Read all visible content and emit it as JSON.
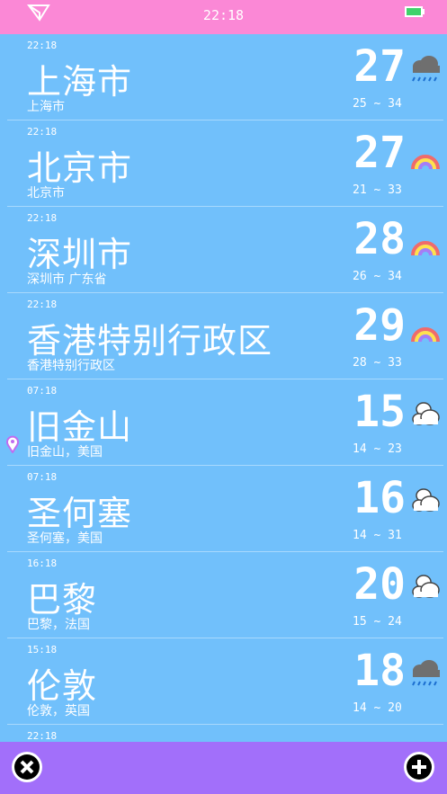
{
  "status_bar": {
    "time": "22:18",
    "location_icon": "location-arrow-icon",
    "battery_icon": "battery-icon"
  },
  "cities": [
    {
      "local_time": "22:18",
      "name": "上海市",
      "subtitle": "上海市",
      "temp": "27",
      "range": "25 ~ 34",
      "weather_icon": "rain-cloud-icon",
      "current_location": false
    },
    {
      "local_time": "22:18",
      "name": "北京市",
      "subtitle": "北京市",
      "temp": "27",
      "range": "21 ~ 33",
      "weather_icon": "rainbow-icon",
      "current_location": false
    },
    {
      "local_time": "22:18",
      "name": "深圳市",
      "subtitle": "深圳市 广东省",
      "temp": "28",
      "range": "26 ~ 34",
      "weather_icon": "rainbow-icon",
      "current_location": false
    },
    {
      "local_time": "22:18",
      "name": "香港特别行政区",
      "subtitle": "香港特别行政区",
      "temp": "29",
      "range": "28 ~ 33",
      "weather_icon": "rainbow-icon",
      "current_location": false
    },
    {
      "local_time": "07:18",
      "name": "旧金山",
      "subtitle": "旧金山，美国",
      "temp": "15",
      "range": "14 ~ 23",
      "weather_icon": "cloudy-icon",
      "current_location": true
    },
    {
      "local_time": "07:18",
      "name": "圣何塞",
      "subtitle": "圣何塞，美国",
      "temp": "16",
      "range": "14 ~ 31",
      "weather_icon": "cloudy-icon",
      "current_location": false
    },
    {
      "local_time": "16:18",
      "name": "巴黎",
      "subtitle": "巴黎，法国",
      "temp": "20",
      "range": "15 ~ 24",
      "weather_icon": "cloudy-icon",
      "current_location": false
    },
    {
      "local_time": "15:18",
      "name": "伦敦",
      "subtitle": "伦敦，英国",
      "temp": "18",
      "range": "14 ~ 20",
      "weather_icon": "rain-cloud-icon",
      "current_location": false
    },
    {
      "local_time": "22:18",
      "name": "",
      "subtitle": "",
      "temp": "",
      "range": "",
      "weather_icon": "",
      "current_location": false
    }
  ],
  "bottom_bar": {
    "close_icon": "close-icon",
    "add_icon": "add-icon"
  },
  "colors": {
    "status_bar": "#fb88d6",
    "background": "#71c0fb",
    "bottom_bar": "#a26ffa",
    "battery": "#3fd36b",
    "pin": "#c06cf0"
  }
}
